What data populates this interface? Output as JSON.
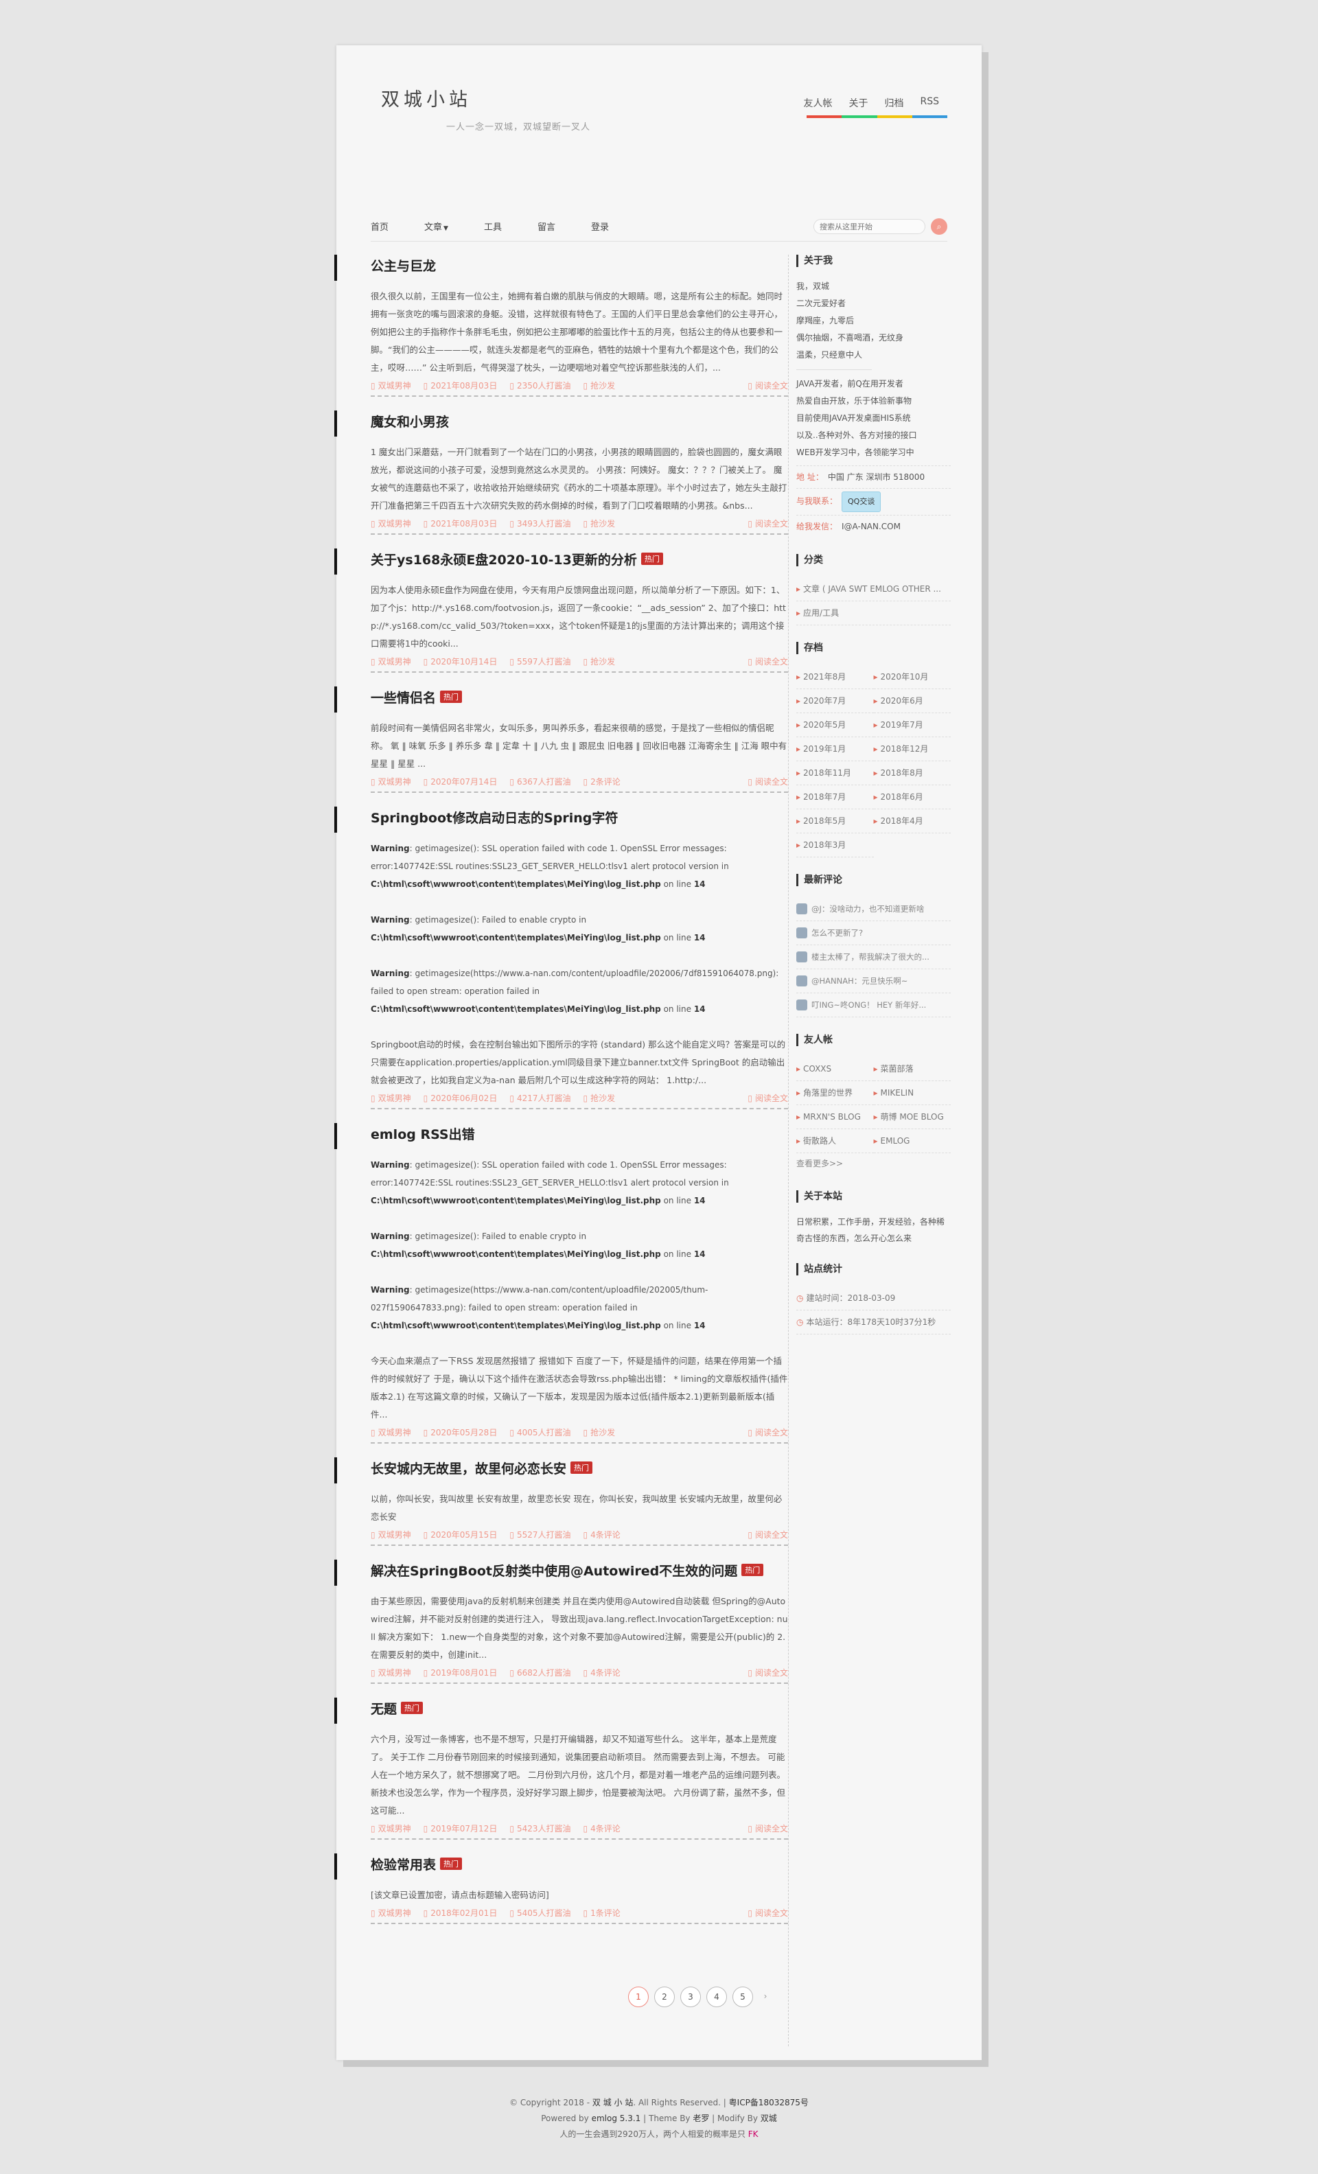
{
  "site": {
    "title": "双城小站",
    "subtitle": "一人一念一双城，双城望断一叉人"
  },
  "topnav": [
    "友人帐",
    "关于",
    "归档",
    "RSS"
  ],
  "rainbow": [
    "#e74c3c",
    "#2ecc71",
    "#f1c40f",
    "#3498db"
  ],
  "mainnav": {
    "home": "首页",
    "articles": "文章",
    "tools": "工具",
    "guestbook": "留言",
    "login": "登录"
  },
  "search": {
    "placeholder": "搜索从这里开始",
    "button_icon": "search-icon"
  },
  "posts": [
    {
      "title": "公主与巨龙",
      "hot": "",
      "excerpt": "很久很久以前，王国里有一位公主，她拥有着白嫩的肌肤与俏皮的大眼睛。嗯，这是所有公主的标配。她同时拥有一张贪吃的嘴与圆滚滚的身躯。没错，这样就很有特色了。王国的人们平日里总会拿他们的公主寻开心，例如把公主的手指称作十条胖毛毛虫，例如把公主那嘟嘟的脸蛋比作十五的月亮，包括公主的侍从也要参和一脚。“我们的公主————哎，就连头发都是老气的亚麻色，牺牲的姑娘十个里有九个都是这个色，我们的公主，哎呀……” 公主听到后，气得哭湿了枕头，一边哽咽地对着空气控诉那些肤浅的人们，...",
      "author": "双城男神",
      "date": "2021年08月03日",
      "views": "2350人打酱油",
      "comments": "抢沙发",
      "read": "阅读全文"
    },
    {
      "title": "魔女和小男孩",
      "hot": "",
      "excerpt": "1 魔女出门采蘑菇，一开门就看到了一个站在门口的小男孩，小男孩的眼睛圆圆的，脸袋也圆圆的，魔女满眼放光，都说这间的小孩子可爱，没想到竟然这么水灵灵的。 小男孩：阿姨好。 魔女：？？？门被关上了。 魔女被气的连蘑菇也不采了，收拾收拾开始继续研究《药水的二十项基本原理》。半个小时过去了，她左头主敲打开门准备把第三千四百五十六次研究失败的药水倒掉的时候，看到了门口哎着眼睛的小男孩。&nbs...",
      "author": "双城男神",
      "date": "2021年08月03日",
      "views": "3493人打酱油",
      "comments": "抢沙发",
      "read": "阅读全文"
    },
    {
      "title": "关于ys168永硕E盘2020-10-13更新的分析",
      "hot": "热门",
      "excerpt": "因为本人使用永硕E盘作为网盘在使用，今天有用户反馈网盘出现问题，所以简单分析了一下原因。如下：1、加了个js：http://*.ys168.com/footvosion.js，返回了一条cookie：“__ads_session” 2、加了个接口：http://*.ys168.com/cc_valid_503/?token=xxx，这个token怀疑是1的js里面的方法计算出来的；调用这个接口需要将1中的cooki...",
      "author": "双城男神",
      "date": "2020年10月14日",
      "views": "5597人打酱油",
      "comments": "抢沙发",
      "read": "阅读全文"
    },
    {
      "title": "一些情侣名",
      "hot": "热门",
      "excerpt": "前段时间有一美情侣网名非常火，女叫乐多，男叫养乐多，看起来很萌的感觉，于是找了一些相似的情侣昵称。 氧 ‖ 味氧 乐多 ‖ 养乐多 韋 ‖ 定韋 十 ‖ 八九 虫 ‖ 跟屁虫 旧电器 ‖ 回收旧电器 江海寄余生 ‖ 江海 眼中有星星 ‖ 星星 ...",
      "author": "双城男神",
      "date": "2020年07月14日",
      "views": "6367人打酱油",
      "comments": "2条评论",
      "read": "阅读全文"
    },
    {
      "title": "Springboot修改启动日志的Spring字符",
      "hot": "",
      "warnings": [
        {
          "label": "Warning",
          "msg": ": getimagesize(): SSL operation failed with code 1. OpenSSL Error messages: error:1407742E:SSL routines:SSL23_GET_SERVER_HELLO:tlsv1 alert protocol version in",
          "file": "C:\\html\\csoft\\wwwroot\\content\\templates\\MeiYing\\log_list.php",
          "line_prefix": " on line ",
          "line": "14"
        },
        {
          "label": "Warning",
          "msg": ": getimagesize(): Failed to enable crypto in",
          "file": "C:\\html\\csoft\\wwwroot\\content\\templates\\MeiYing\\log_list.php",
          "line_prefix": " on line ",
          "line": "14"
        },
        {
          "label": "Warning",
          "msg": ": getimagesize(https://www.a-nan.com/content/uploadfile/202006/7df81591064078.png): failed to open stream: operation failed in",
          "file": "C:\\html\\csoft\\wwwroot\\content\\templates\\MeiYing\\log_list.php",
          "line_prefix": " on line ",
          "line": "14"
        }
      ],
      "excerpt": "Springboot启动的时候，会在控制台输出如下图所示的字符 (standard) 那么这个能自定义吗？答案是可以的 只需要在application.properties/application.yml同级目录下建立banner.txt文件 SpringBoot 的启动输出就会被更改了，比如我自定义为a-nan 最后附几个可以生成这种字符的网站： 1.http:/...",
      "author": "双城男神",
      "date": "2020年06月02日",
      "views": "4217人打酱油",
      "comments": "抢沙发",
      "read": "阅读全文"
    },
    {
      "title": "emlog RSS出错",
      "hot": "",
      "warnings": [
        {
          "label": "Warning",
          "msg": ": getimagesize(): SSL operation failed with code 1. OpenSSL Error messages: error:1407742E:SSL routines:SSL23_GET_SERVER_HELLO:tlsv1 alert protocol version in",
          "file": "C:\\html\\csoft\\wwwroot\\content\\templates\\MeiYing\\log_list.php",
          "line_prefix": " on line ",
          "line": "14"
        },
        {
          "label": "Warning",
          "msg": ": getimagesize(): Failed to enable crypto in",
          "file": "C:\\html\\csoft\\wwwroot\\content\\templates\\MeiYing\\log_list.php",
          "line_prefix": " on line ",
          "line": "14"
        },
        {
          "label": "Warning",
          "msg": ": getimagesize(https://www.a-nan.com/content/uploadfile/202005/thum-027f1590647833.png): failed to open stream: operation failed in",
          "file": "C:\\html\\csoft\\wwwroot\\content\\templates\\MeiYing\\log_list.php",
          "line_prefix": " on line ",
          "line": "14"
        }
      ],
      "excerpt": "今天心血来潮点了一下RSS 发现居然报错了 报错如下 百度了一下，怀疑是插件的问题，结果在停用第一个插件的时候就好了 于是，确认以下这个插件在激活状态会导致rss.php输出出错： * liming的文章版权插件(插件版本2.1) 在写这篇文章的时候，又确认了一下版本，发现是因为版本过低(插件版本2.1)更新到最新版本(插件...",
      "author": "双城男神",
      "date": "2020年05月28日",
      "views": "4005人打酱油",
      "comments": "抢沙发",
      "read": "阅读全文"
    },
    {
      "title": "长安城内无故里，故里何必恋长安",
      "hot": "热门",
      "excerpt": "以前，你叫长安，我叫故里 长安有故里，故里恋长安 现在，你叫长安，我叫故里 长安城内无故里，故里何必恋长安",
      "author": "双城男神",
      "date": "2020年05月15日",
      "views": "5527人打酱油",
      "comments": "4条评论",
      "read": "阅读全文"
    },
    {
      "title": "解决在SpringBoot反射类中使用@Autowired不生效的问题",
      "hot": "热门",
      "excerpt": "由于某些原因，需要使用java的反射机制来创建类 并且在类内使用@Autowired自动装载 但Spring的@Autowired注解，并不能对反射创建的类进行注入， 导致出现java.lang.reflect.InvocationTargetException: null 解决方案如下： 1.new一个自身类型的对象，这个对象不要加@Autowired注解，需要是公开(public)的 2.在需要反射的类中，创建init...",
      "author": "双城男神",
      "date": "2019年08月01日",
      "views": "6682人打酱油",
      "comments": "4条评论",
      "read": "阅读全文"
    },
    {
      "title": "无题",
      "hot": "热门",
      "excerpt": "六个月，没写过一条博客，也不是不想写，只是打开编辑器，却又不知道写些什么。 这半年，基本上是荒度了。 关于工作 二月份春节刚回来的时候接到通知，说集团要启动新项目。 然而需要去到上海，不想去。 可能人在一个地方呆久了，就不想挪窝了吧。 二月份到六月份，这几个月，都是对着一堆老产品的运维问题列表。 新技术也没怎么学，作为一个程序员，没好好学习跟上脚步，怕是要被淘汰吧。 六月份调了薪，虽然不多，但这可能...",
      "author": "双城男神",
      "date": "2019年07月12日",
      "views": "5423人打酱油",
      "comments": "4条评论",
      "read": "阅读全文"
    },
    {
      "title": "检验常用表",
      "hot": "热门",
      "excerpt": "[该文章已设置加密，请点击标题输入密码访问]",
      "author": "双城男神",
      "date": "2018年02月01日",
      "views": "5405人打酱油",
      "comments": "1条评论",
      "read": "阅读全文"
    }
  ],
  "sidebar": {
    "about": {
      "title": "关于我",
      "lines1": [
        "我，双城",
        "二次元爱好者",
        "摩羯座，九零后",
        "偶尔抽烟，不喜喝酒，无纹身",
        "温柔，只经意中人"
      ],
      "lines2": [
        "JAVA开发者，前Q在用开发者",
        "热爱自由开放，乐于体验新事物",
        "目前使用JAVA开发桌面HIS系统",
        "以及..各种对外、各方对接的接口",
        "WEB开发学习中，各领能学习中"
      ],
      "address_label": "地  址：",
      "address": "中国 广东 深圳市 518000",
      "contact_label": "与我联系：",
      "qq": "QQ交谈",
      "email_label": "给我发信：",
      "email": "I@A-NAN.COM"
    },
    "categories": {
      "title": "分类",
      "items": [
        "文章 ( JAVA SWT EMLOG OTHER ...",
        "应用/工具"
      ]
    },
    "archive": {
      "title": "存档",
      "items": [
        "2021年8月",
        "2020年10月",
        "2020年7月",
        "2020年6月",
        "2020年5月",
        "2019年7月",
        "2019年1月",
        "2018年12月",
        "2018年11月",
        "2018年8月",
        "2018年7月",
        "2018年6月",
        "2018年5月",
        "2018年4月",
        "2018年3月"
      ]
    },
    "comments": {
      "title": "最新评论",
      "items": [
        "@J：没啥动力，也不知道更新啥",
        "怎么不更新了?",
        "楼主太棒了，帮我解决了很大的...",
        "@HANNAH：元旦快乐啊~",
        "叮ING~咚ONG！ HEY 新年好..."
      ]
    },
    "friends": {
      "title": "友人帐",
      "items": [
        "COXXS",
        "菜菌部落",
        "角落里的世界",
        "MIKELIN",
        "MRXN'S BLOG",
        "萌博 MOE BLOG",
        "街散路人",
        "EMLOG"
      ],
      "more": "查看更多>>"
    },
    "site_about": {
      "title": "关于本站",
      "text": "日常积累，工作手册，开发经验，各种稀奇古怪的东西，怎么开心怎么来"
    },
    "stats": {
      "title": "站点统计",
      "built_label": "建站时间：",
      "built": "2018-03-09",
      "run_label": "本站运行：",
      "run": "8年178天10时37分1秒"
    }
  },
  "pager": {
    "pages": [
      "1",
      "2",
      "3",
      "4",
      "5"
    ],
    "next_icon": "next-page-icon"
  },
  "footer": {
    "copyright": "© Copyright 2018 - ",
    "site": "双 城 小 站",
    "rights": ". All Rights Reserved. | ",
    "icp": "粤ICP备18032875号",
    "powered": "Powered by ",
    "emlog": "emlog 5.3.1",
    "theme": " | Theme By ",
    "theme_author": "老罗",
    "modify": " | Modify By ",
    "modify_author": "双城",
    "quote": "人的一生会遇到2920万人，两个人相爱的概率是只 ",
    "fk": "FK"
  }
}
